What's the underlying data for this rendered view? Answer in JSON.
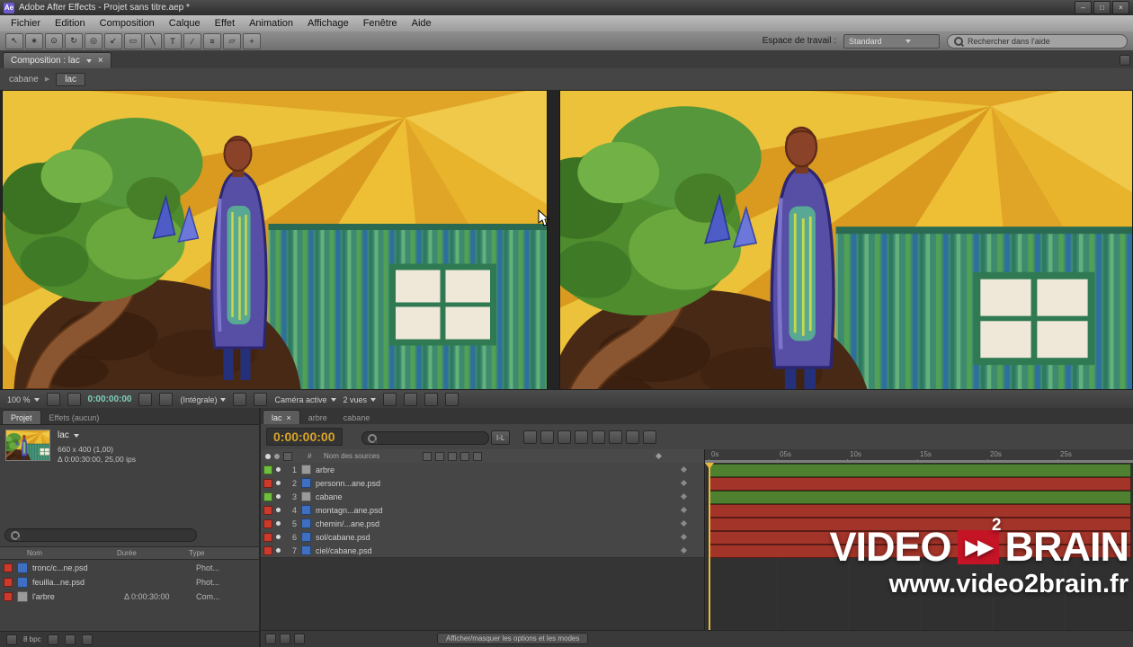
{
  "window": {
    "icon_label": "Ae",
    "title": "Adobe After Effects - Projet sans titre.aep *",
    "minimize": "–",
    "maximize": "□",
    "close": "×"
  },
  "menu": {
    "items": [
      "Fichier",
      "Edition",
      "Composition",
      "Calque",
      "Effet",
      "Animation",
      "Affichage",
      "Fenêtre",
      "Aide"
    ]
  },
  "toolbar": {
    "tools": [
      {
        "name": "selection",
        "glyph": "↖"
      },
      {
        "name": "hand",
        "glyph": "∗"
      },
      {
        "name": "zoom",
        "glyph": "⊙"
      },
      {
        "name": "rotation",
        "glyph": "↻"
      },
      {
        "name": "unified-camera",
        "glyph": "◎"
      },
      {
        "name": "pan-behind",
        "glyph": "↙"
      },
      {
        "name": "mask-shape",
        "glyph": "▭"
      },
      {
        "name": "pen",
        "glyph": "╲"
      },
      {
        "name": "text",
        "glyph": "T"
      },
      {
        "name": "brush",
        "glyph": "∕"
      },
      {
        "name": "clone-stamp",
        "glyph": "≡"
      },
      {
        "name": "eraser",
        "glyph": "▱"
      },
      {
        "name": "puppet",
        "glyph": "+"
      }
    ],
    "workspace_label": "Espace de travail :",
    "workspace_value": "Standard",
    "search_placeholder": "Rechercher dans l'aide"
  },
  "comp_panel": {
    "tab": "Composition : lac",
    "tab_close": "×",
    "breadcrumb_parent": "cabane",
    "breadcrumb_current": "lac"
  },
  "viewer_footer": {
    "zoom": "100 %",
    "timecode": "0:00:00:00",
    "resolution": "(Intégrale)",
    "camera": "Caméra active",
    "views": "2 vues"
  },
  "project_panel": {
    "tab_projet": "Projet",
    "tab_effets": "Effets (aucun)",
    "item_name": "lac",
    "item_info1": "660 x 400 (1,00)",
    "item_info2": "Δ 0:00:30:00, 25,00 ips",
    "col_name": "Nom",
    "col_duration": "Durée",
    "col_type": "Type",
    "items": [
      {
        "name": "tronc/c...ne.psd",
        "duration": "",
        "type": "Phot...",
        "chip": "#cc3a2c"
      },
      {
        "name": "feuilla...ne.psd",
        "duration": "",
        "type": "Phot...",
        "chip": "#cc3a2c"
      },
      {
        "name": "l'arbre",
        "duration": "Δ 0:00:30:00",
        "type": "Com...",
        "chip": "#cc3a2c"
      }
    ],
    "footer_depth": "8 bpc"
  },
  "timeline": {
    "tab_lac": "lac",
    "tab_close": "×",
    "tab_arbre": "arbre",
    "tab_cabane": "cabane",
    "timecode": "0:00:00:00",
    "inout": "I-L",
    "hash": "#",
    "source_column": "Nom des sources",
    "ruler": [
      "0s",
      "05s",
      "10s",
      "15s",
      "20s",
      "25s"
    ],
    "layers": [
      {
        "index": "1",
        "name": "arbre",
        "chip": "#6fbf3f",
        "bar": "#4e8030"
      },
      {
        "index": "2",
        "name": "personn...ane.psd",
        "chip": "#cc3a2c",
        "bar": "#a33429"
      },
      {
        "index": "3",
        "name": "cabane",
        "chip": "#6fbf3f",
        "bar": "#4e8030"
      },
      {
        "index": "4",
        "name": "montagn...ane.psd",
        "chip": "#cc3a2c",
        "bar": "#a33429"
      },
      {
        "index": "5",
        "name": "chemin/...ane.psd",
        "chip": "#cc3a2c",
        "bar": "#a33429"
      },
      {
        "index": "6",
        "name": "sol/cabane.psd",
        "chip": "#cc3a2c",
        "bar": "#a33429"
      },
      {
        "index": "7",
        "name": "ciel/cabane.psd",
        "chip": "#cc3a2c",
        "bar": "#a33429"
      }
    ],
    "status_button": "Afficher/masquer les options et les modes"
  },
  "watermark": {
    "brand_left": "VIDEO",
    "chevrons": "▶▶",
    "sup": "2",
    "brand_right": "BRAIN",
    "url": "www.video2brain.fr",
    "red": "#c41425"
  }
}
